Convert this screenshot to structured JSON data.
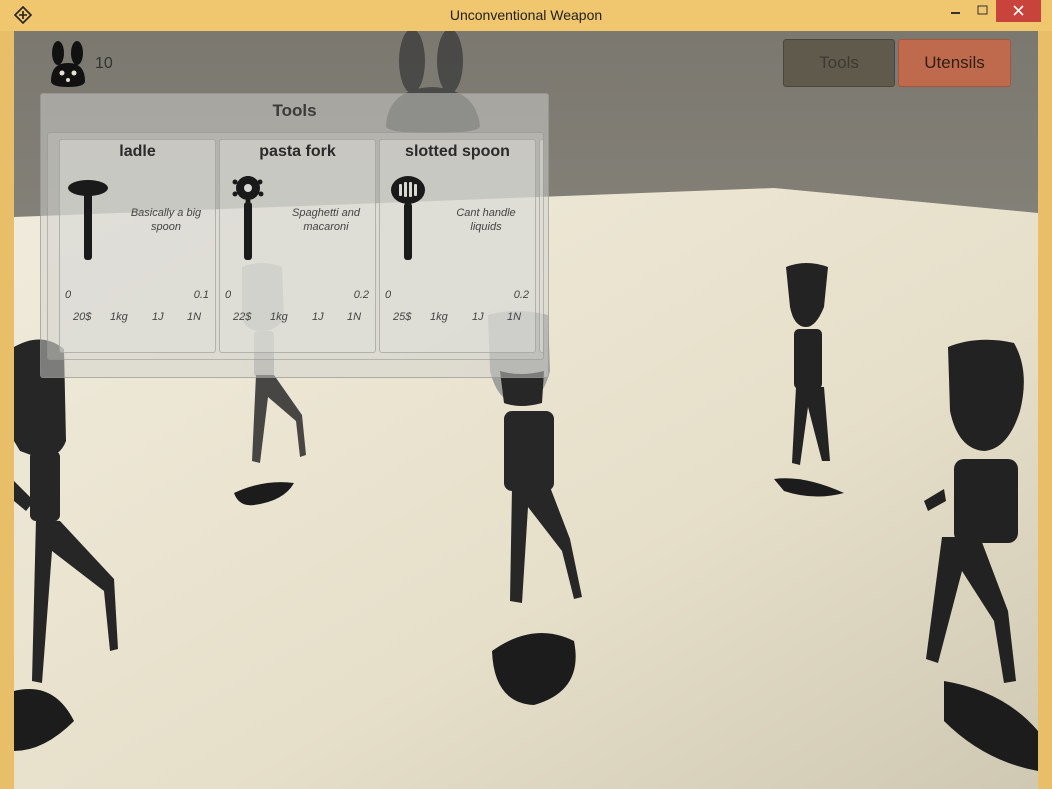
{
  "window": {
    "title": "Unconventional Weapon"
  },
  "hud": {
    "score": "10",
    "score_icon": "bunny-head-icon"
  },
  "tabs": [
    {
      "label": "Tools"
    },
    {
      "label": "Utensils"
    }
  ],
  "panel": {
    "title": "Tools",
    "items": [
      {
        "name": "ladle",
        "icon": "ladle-icon",
        "description": "Basically a big spoon",
        "range_min": "0",
        "range_max": "0.1",
        "price": "20$",
        "mass": "1kg",
        "energy": "1J",
        "force": "1N"
      },
      {
        "name": "pasta fork",
        "icon": "pasta-fork-icon",
        "description": "Spaghetti and macaroni",
        "range_min": "0",
        "range_max": "0.2",
        "price": "22$",
        "mass": "1kg",
        "energy": "1J",
        "force": "1N"
      },
      {
        "name": "slotted spoon",
        "icon": "slotted-spoon-icon",
        "description": "Cant handle liquids",
        "range_min": "0",
        "range_max": "0.2",
        "price": "25$",
        "mass": "1kg",
        "energy": "1J",
        "force": "1N"
      }
    ]
  },
  "colors": {
    "title_bar": "#f0c66e",
    "close_button": "#c7433b",
    "tools_tab": "#5f5a4c",
    "utensils_tab": "#c06a4d",
    "floor": "#e8e1cd",
    "wall": "#8a877f"
  }
}
